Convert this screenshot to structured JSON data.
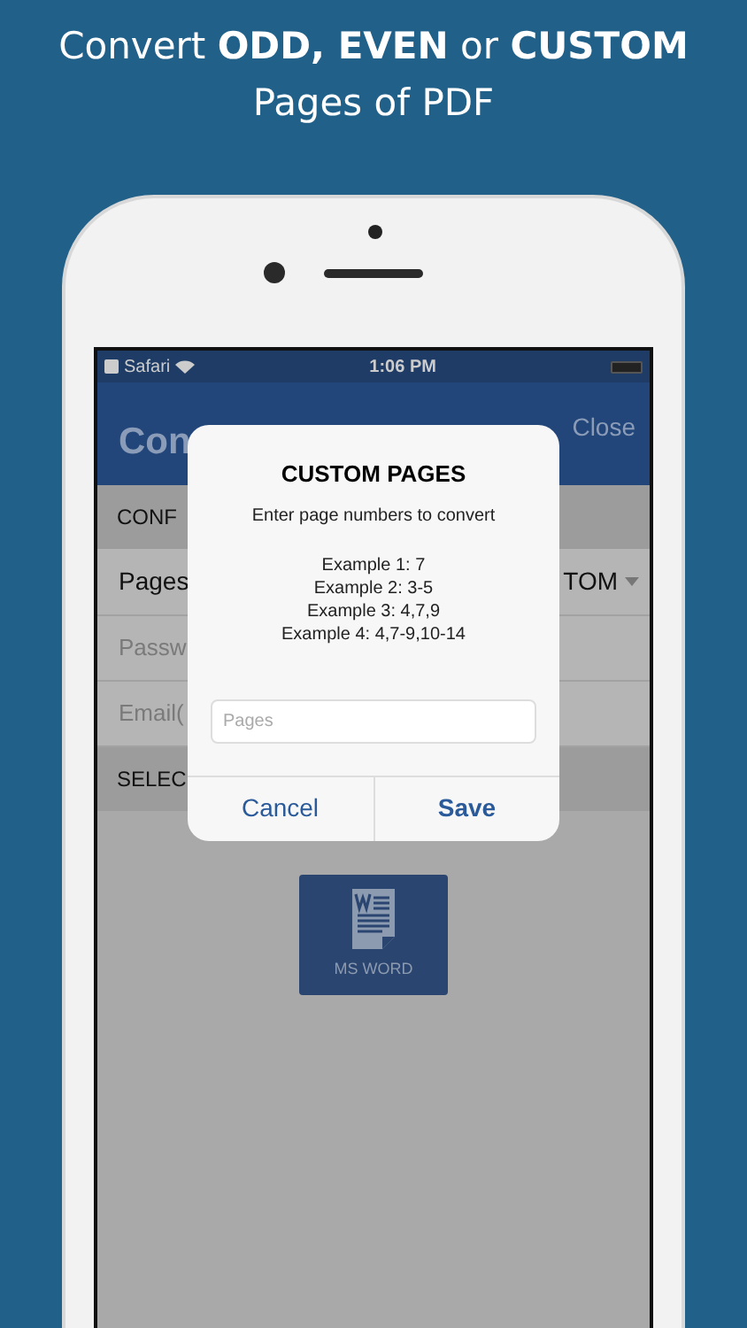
{
  "headline": {
    "line_1": "Convert **ODD, EVEN** or **CUSTOM**",
    "line_2": "Pages of PDF"
  },
  "status_bar": {
    "back_app": "Safari",
    "time": "1:06 PM"
  },
  "nav_bar": {
    "title": "Con",
    "action": "Close"
  },
  "form": [
    {
      "kind": "header",
      "label": "CONF"
    },
    {
      "kind": "picker",
      "label": "Pages",
      "value": "TOM"
    },
    {
      "kind": "field",
      "placeholder": "Passw"
    },
    {
      "kind": "field",
      "placeholder": "Email("
    },
    {
      "kind": "header",
      "label": "SELEC"
    }
  ],
  "formats": [
    {
      "label": "MS WORD"
    }
  ],
  "dialog": {
    "title": "CUSTOM PAGES",
    "message": "Enter page numbers to convert",
    "examples": [
      "Example 1: 7",
      "Example 2: 3-5",
      "Example 3: 4,7,9",
      "Example 4: 4,7-9,10-14"
    ],
    "input": {
      "placeholder": "Pages"
    },
    "buttons": [
      {
        "label": "Cancel",
        "bold": false
      },
      {
        "label": "Save",
        "bold": true
      }
    ]
  }
}
